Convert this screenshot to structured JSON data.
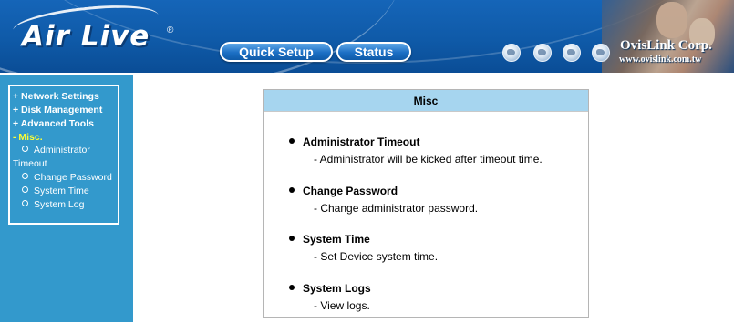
{
  "header": {
    "logo_text": "Air Live",
    "logo_registered": "®",
    "nav": [
      {
        "label": "Quick Setup"
      },
      {
        "label": "Status"
      }
    ],
    "globe_icons": [
      "globe-icon",
      "globe-icon",
      "globe-icon",
      "globe-icon"
    ],
    "company_name": "OvisLink Corp.",
    "company_url": "www.ovislink.com.tw"
  },
  "sidebar": {
    "menu": [
      {
        "label": "+ Network Settings",
        "active": false
      },
      {
        "label": "+ Disk Management",
        "active": false
      },
      {
        "label": "+ Advanced Tools",
        "active": false
      },
      {
        "label": "- Misc.",
        "active": true
      }
    ],
    "submenu": [
      {
        "label_line1": "Administrator",
        "label_line2": "Timeout"
      },
      {
        "label": "Change Password"
      },
      {
        "label": "System Time"
      },
      {
        "label": "System Log"
      }
    ]
  },
  "main": {
    "panel_title": "Misc",
    "entries": [
      {
        "title": "Administrator Timeout",
        "desc": "- Administrator will be kicked after timeout time."
      },
      {
        "title": "Change Password",
        "desc": "- Change administrator password."
      },
      {
        "title": "System Time",
        "desc": "- Set Device system time."
      },
      {
        "title": "System Logs",
        "desc": "- View logs."
      }
    ]
  },
  "colors": {
    "header_blue": "#1565b8",
    "sidebar_blue": "#3399cc",
    "active_menu": "#ffff33",
    "panel_header": "#a6d5ef"
  }
}
